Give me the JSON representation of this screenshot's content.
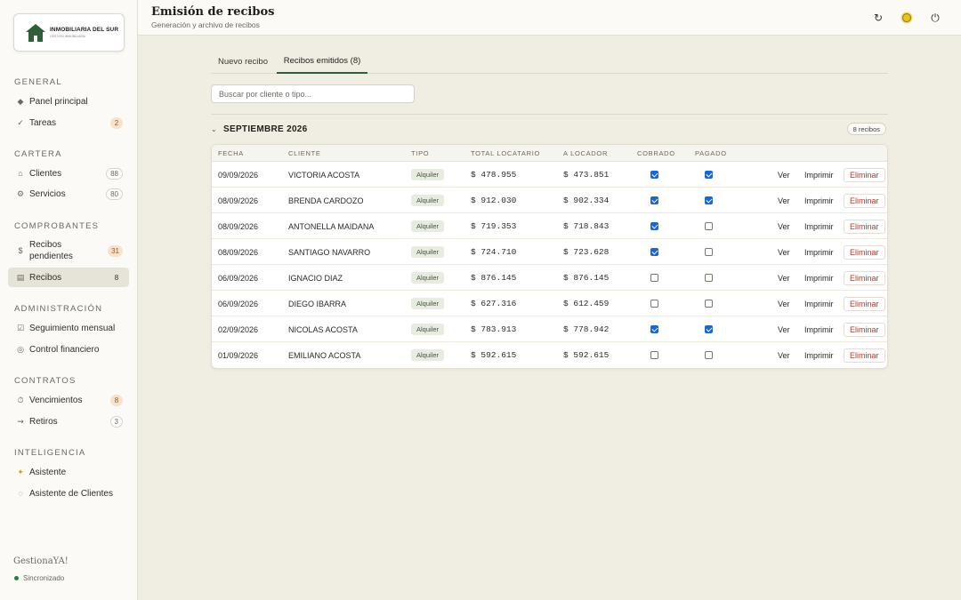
{
  "sidebar": {
    "logo": {
      "name": "INMOBILIARIA DEL SUR",
      "sub": "GESTION INMOBILIARIA"
    },
    "sections": [
      {
        "label": "GENERAL"
      },
      {
        "label": "CARTERA"
      },
      {
        "label": "COMPROBANTES"
      },
      {
        "label": "ADMINISTRACIÓN"
      },
      {
        "label": "CONTRATOS"
      },
      {
        "label": "INTELIGENCIA"
      }
    ],
    "items": [
      {
        "label": "Panel principal",
        "icon": "diamond-icon"
      },
      {
        "label": "Tareas",
        "icon": "check-icon",
        "badge": "2"
      },
      {
        "label": "Clientes",
        "icon": "home-icon",
        "badge": "88"
      },
      {
        "label": "Servicios",
        "icon": "gear-icon",
        "badge": "80"
      },
      {
        "label": "Recibos pendientes",
        "icon": "dollar-icon",
        "badge": "31"
      },
      {
        "label": "Recibos",
        "icon": "receipt-icon",
        "badge": "8"
      },
      {
        "label": "Seguimiento mensual",
        "icon": "checkbox-icon"
      },
      {
        "label": "Control financiero",
        "icon": "coin-icon"
      },
      {
        "label": "Vencimientos",
        "icon": "clock-icon",
        "badge": "8"
      },
      {
        "label": "Retiros",
        "icon": "arrow-icon",
        "badge": "3"
      },
      {
        "label": "Asistente",
        "icon": "sparkle-icon"
      },
      {
        "label": "Asistente de Clientes",
        "icon": "chat-icon"
      }
    ],
    "brand": "GestionaYA!",
    "sync_status": "Sincronizado"
  },
  "header": {
    "title": "Emisión de recibos",
    "subtitle": "Generación y archivo de recibos",
    "icons": [
      "refresh-icon",
      "sun-icon",
      "power-icon"
    ]
  },
  "tabs": [
    {
      "label": "Nuevo recibo"
    },
    {
      "label": "Recibos emitidos (8)"
    }
  ],
  "search": {
    "placeholder": "Buscar por cliente o tipo...",
    "value": ""
  },
  "group": {
    "month": "SEPTIEMBRE 2026",
    "count": "8 recibos"
  },
  "table": {
    "columns": [
      "FECHA",
      "CLIENTE",
      "TIPO",
      "TOTAL LOCATARIO",
      "A LOCADOR",
      "COBRADO",
      "PAGADO"
    ],
    "actions": {
      "view": "Ver",
      "print": "Imprimir",
      "delete": "Eliminar"
    },
    "rows": [
      {
        "fecha": "09/09/2026",
        "cliente": "VICTORIA ACOSTA",
        "tipo": "Alquiler",
        "total": "$ 478.955",
        "locador": "$ 473.851",
        "cobrado": true,
        "pagado": true
      },
      {
        "fecha": "08/09/2026",
        "cliente": "BRENDA CARDOZO",
        "tipo": "Alquiler",
        "total": "$ 912.030",
        "locador": "$ 902.334",
        "cobrado": true,
        "pagado": true
      },
      {
        "fecha": "08/09/2026",
        "cliente": "ANTONELLA MAIDANA",
        "tipo": "Alquiler",
        "total": "$ 719.353",
        "locador": "$ 718.843",
        "cobrado": true,
        "pagado": false
      },
      {
        "fecha": "08/09/2026",
        "cliente": "SANTIAGO NAVARRO",
        "tipo": "Alquiler",
        "total": "$ 724.710",
        "locador": "$ 723.628",
        "cobrado": true,
        "pagado": false
      },
      {
        "fecha": "06/09/2026",
        "cliente": "IGNACIO DIAZ",
        "tipo": "Alquiler",
        "total": "$ 876.145",
        "locador": "$ 876.145",
        "cobrado": false,
        "pagado": false
      },
      {
        "fecha": "06/09/2026",
        "cliente": "DIEGO IBARRA",
        "tipo": "Alquiler",
        "total": "$ 627.316",
        "locador": "$ 612.459",
        "cobrado": false,
        "pagado": false
      },
      {
        "fecha": "02/09/2026",
        "cliente": "NICOLAS ACOSTA",
        "tipo": "Alquiler",
        "total": "$ 783.913",
        "locador": "$ 778.942",
        "cobrado": true,
        "pagado": true
      },
      {
        "fecha": "01/09/2026",
        "cliente": "EMILIANO ACOSTA",
        "tipo": "Alquiler",
        "total": "$ 592.615",
        "locador": "$ 592.615",
        "cobrado": false,
        "pagado": false
      }
    ]
  }
}
